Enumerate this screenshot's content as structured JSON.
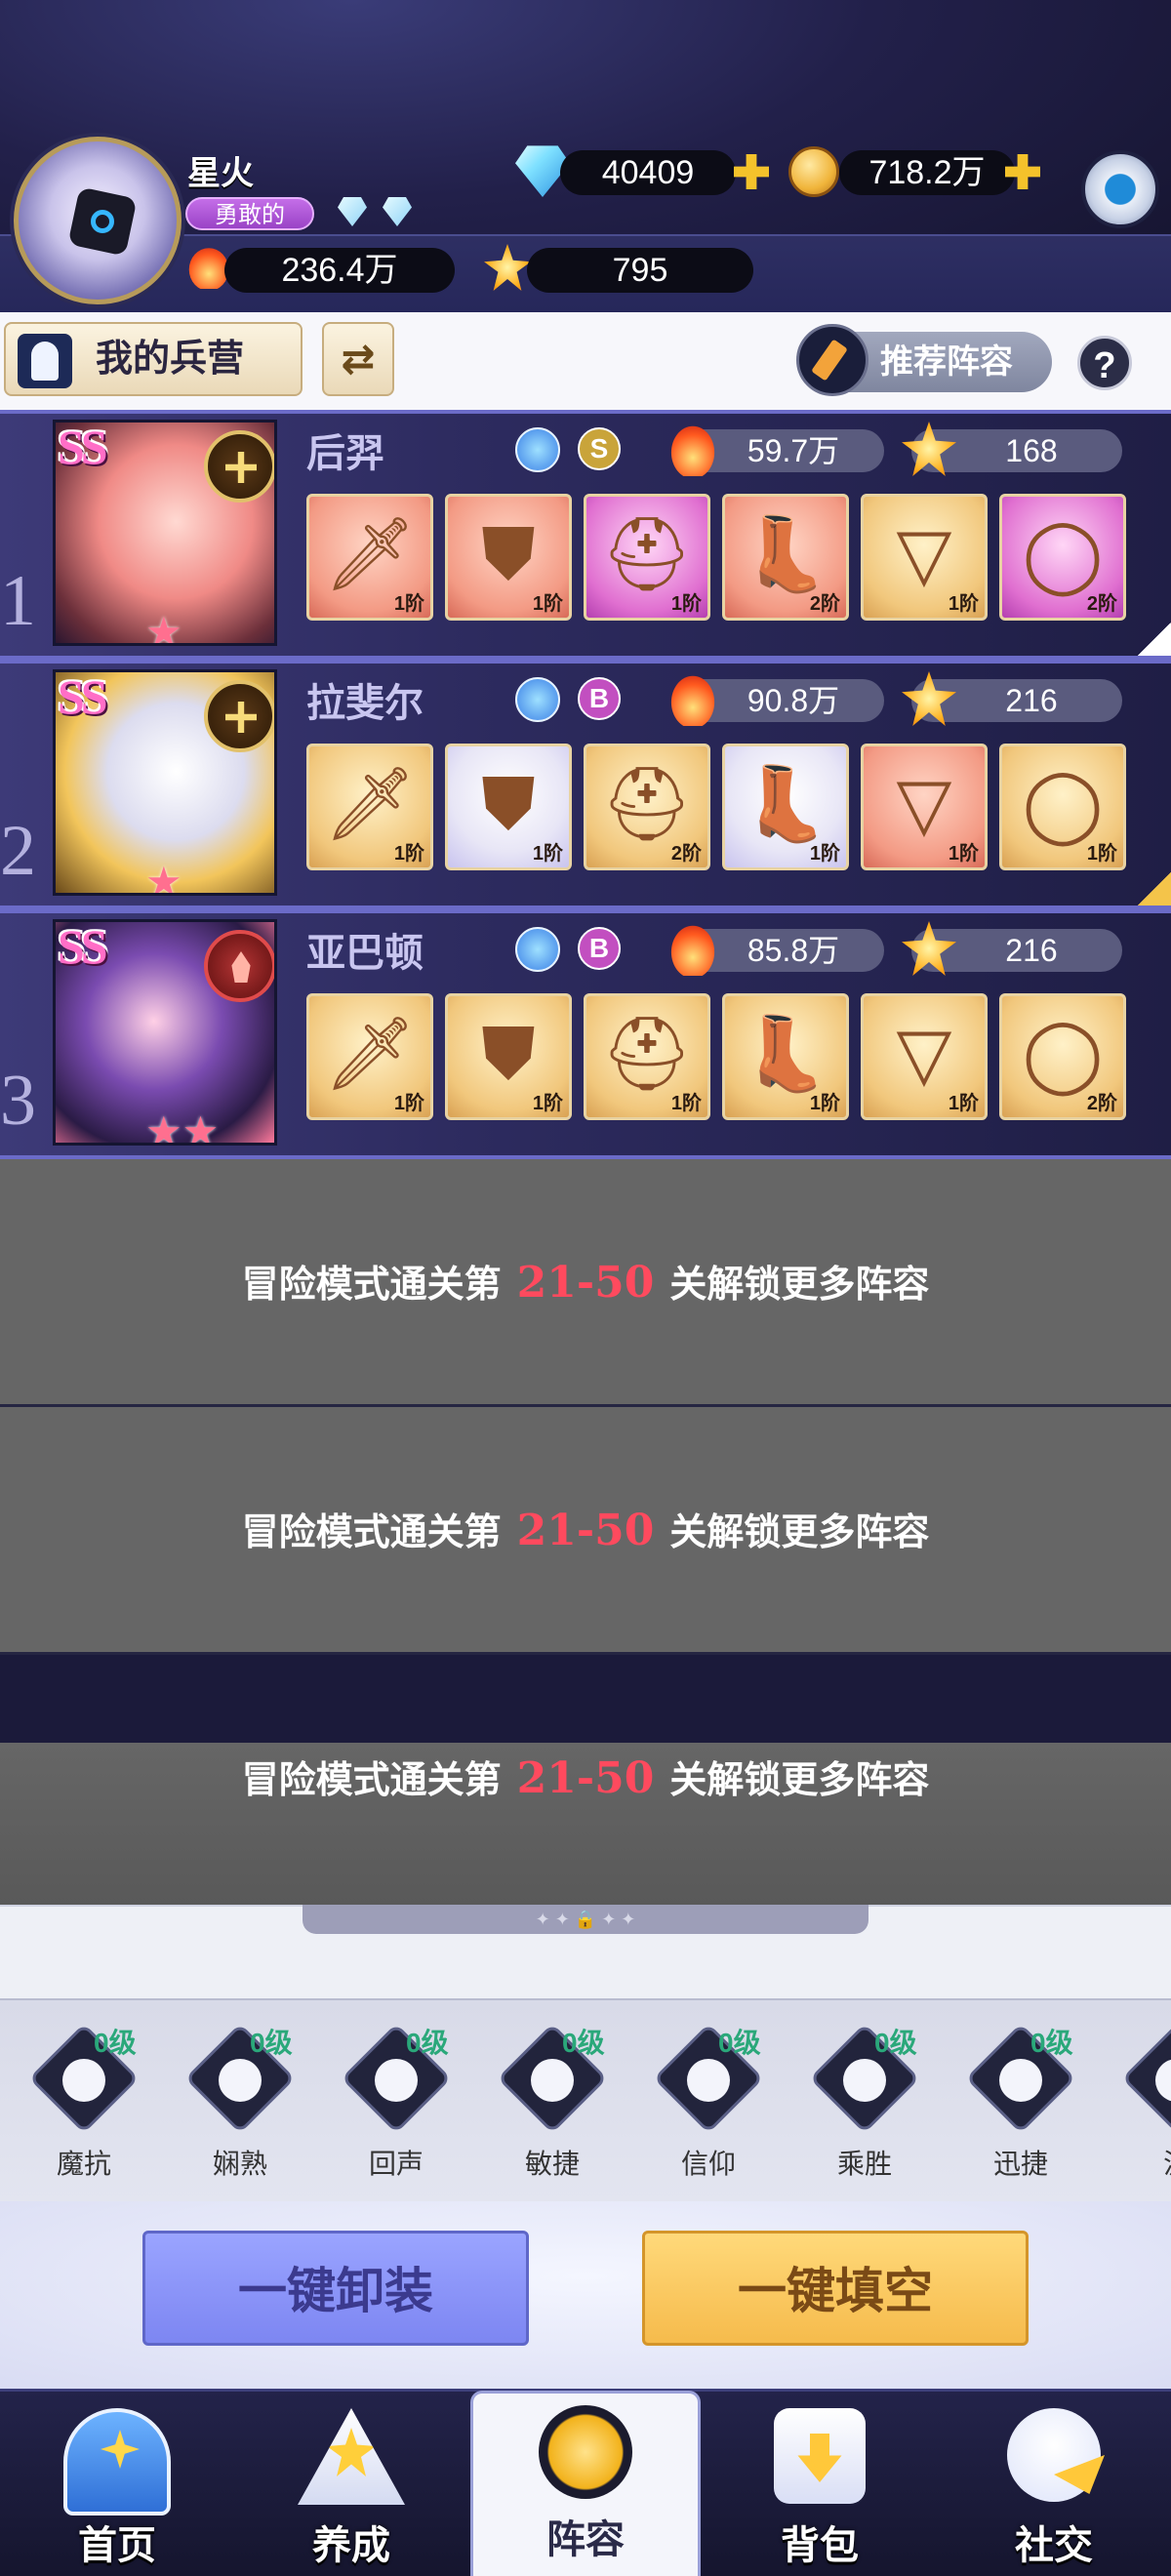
{
  "header": {
    "player_name": "星火",
    "title_badge": "勇敢的",
    "diamonds": "40409",
    "gold": "718.2万",
    "power": "236.4万",
    "stars": "795"
  },
  "toolbar": {
    "barracks_label": "我的兵营",
    "swap_glyph": "⇄",
    "recommend_label": "推荐阵容",
    "help_label": "?"
  },
  "heroes": [
    {
      "index": "1",
      "rank": "SS",
      "name": "后羿",
      "class_icon": "cross-icon",
      "type_icon": "bow-icon",
      "grade": "S",
      "grade_color": "#c9a43a",
      "power": "59.7万",
      "stars": "168",
      "star_count": 1,
      "equipment": [
        {
          "icon": "sword-icon",
          "glyph": "🗡",
          "tier": "red",
          "level": "1阶"
        },
        {
          "icon": "armor-icon",
          "glyph": "⛊",
          "tier": "red",
          "level": "1阶"
        },
        {
          "icon": "helmet-icon",
          "glyph": "⛑",
          "tier": "pink",
          "level": "1阶"
        },
        {
          "icon": "boots-icon",
          "glyph": "👢",
          "tier": "red",
          "level": "2阶"
        },
        {
          "icon": "necklace-icon",
          "glyph": "▽",
          "tier": "gold",
          "level": "1阶"
        },
        {
          "icon": "ring-icon",
          "glyph": "◯",
          "tier": "pink",
          "level": "2阶"
        }
      ]
    },
    {
      "index": "2",
      "rank": "SS",
      "name": "拉斐尔",
      "class_icon": "cross-icon",
      "type_icon": "sword-type-icon",
      "grade": "B",
      "grade_color": "#c24fc0",
      "power": "90.8万",
      "stars": "216",
      "star_count": 1,
      "equipment": [
        {
          "icon": "sword-icon",
          "glyph": "🗡",
          "tier": "gold",
          "level": "1阶"
        },
        {
          "icon": "armor-icon",
          "glyph": "⛊",
          "tier": "silver",
          "level": "1阶"
        },
        {
          "icon": "helmet-icon",
          "glyph": "⛑",
          "tier": "gold",
          "level": "2阶"
        },
        {
          "icon": "boots-icon",
          "glyph": "👢",
          "tier": "silver",
          "level": "1阶"
        },
        {
          "icon": "necklace-icon",
          "glyph": "▽",
          "tier": "red",
          "level": "1阶"
        },
        {
          "icon": "ring-icon",
          "glyph": "◯",
          "tier": "gold",
          "level": "1阶"
        }
      ]
    },
    {
      "index": "3",
      "rank": "SS",
      "name": "亚巴顿",
      "class_icon": "flame-icon",
      "type_icon": "shield-type-icon",
      "grade": "B",
      "grade_color": "#c24fc0",
      "power": "85.8万",
      "stars": "216",
      "star_count": 2,
      "equipment": [
        {
          "icon": "sword-icon",
          "glyph": "🗡",
          "tier": "gold",
          "level": "1阶"
        },
        {
          "icon": "armor-icon",
          "glyph": "⛊",
          "tier": "gold",
          "level": "1阶"
        },
        {
          "icon": "helmet-icon",
          "glyph": "⛑",
          "tier": "gold",
          "level": "1阶"
        },
        {
          "icon": "boots-icon",
          "glyph": "👢",
          "tier": "gold",
          "level": "1阶"
        },
        {
          "icon": "necklace-icon",
          "glyph": "▽",
          "tier": "gold",
          "level": "1阶"
        },
        {
          "icon": "ring-icon",
          "glyph": "◯",
          "tier": "gold",
          "level": "2阶"
        }
      ]
    }
  ],
  "locked_slots": [
    {
      "prefix": "冒险模式通关第",
      "range": "21-50",
      "suffix": "关解锁更多阵容"
    },
    {
      "prefix": "冒险模式通关第",
      "range": "21-50",
      "suffix": "关解锁更多阵容"
    },
    {
      "prefix": "冒险模式通关第",
      "range": "21-50",
      "suffix": "关解锁更多阵容"
    }
  ],
  "talents": [
    {
      "name": "魔抗",
      "level": "0级",
      "icon": "hood-icon"
    },
    {
      "name": "娴熟",
      "level": "0级",
      "icon": "sword-circle-icon"
    },
    {
      "name": "回声",
      "level": "0级",
      "icon": "echo-icon"
    },
    {
      "name": "敏捷",
      "level": "0级",
      "icon": "lightning-icon"
    },
    {
      "name": "信仰",
      "level": "0级",
      "icon": "halo-icon"
    },
    {
      "name": "乘胜",
      "level": "0级",
      "icon": "bolt-circle-icon"
    },
    {
      "name": "迅捷",
      "level": "0级",
      "icon": "swift-icon"
    },
    {
      "name": "汲",
      "level": "",
      "icon": "partial-icon"
    }
  ],
  "actions": {
    "unequip_all": "一键卸装",
    "fill_empty": "一键填空"
  },
  "nav": {
    "home": "首页",
    "train": "养成",
    "team": "阵容",
    "bag": "背包",
    "social": "社交"
  },
  "grabber_text": "✦ ✦   🔒   ✦ ✦"
}
